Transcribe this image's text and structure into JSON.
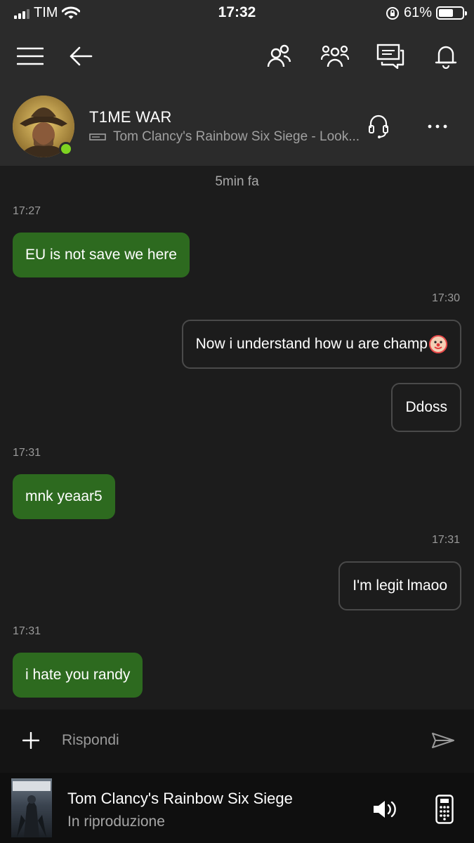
{
  "status_bar": {
    "carrier": "TIM",
    "time": "17:32",
    "battery": "61%",
    "battery_level": 0.61,
    "icons": [
      "signal-icon",
      "wifi-icon",
      "orientation-lock-icon",
      "battery-icon"
    ]
  },
  "nav": {
    "icons": [
      "menu-icon",
      "back-arrow-icon",
      "friends-icon",
      "party-icon",
      "messages-icon",
      "notifications-icon"
    ]
  },
  "contact": {
    "name": "T1ME WAR",
    "status": "Tom Clancy's Rainbow Six Siege - Look...",
    "online": true,
    "icons": [
      "console-icon",
      "headset-icon",
      "more-icon"
    ]
  },
  "messages": {
    "divider": "5min fa",
    "items": [
      {
        "timestamp": "17:27",
        "text": "EU is not save we here",
        "direction": "in"
      },
      {
        "timestamp": "17:30",
        "text": "Now i understand how u are champ",
        "emoji": "clown-face-emoji",
        "direction": "out"
      },
      {
        "timestamp": "",
        "text": "Ddoss",
        "direction": "out"
      },
      {
        "timestamp": "17:31",
        "text": "mnk yeaar5",
        "direction": "in"
      },
      {
        "timestamp": "17:31",
        "text": "I'm legit lmaoo",
        "direction": "out"
      },
      {
        "timestamp": "17:31",
        "text": "i hate you randy",
        "direction": "in"
      }
    ]
  },
  "reply": {
    "placeholder": "Rispondi",
    "value": "",
    "icons": [
      "plus-icon",
      "send-icon"
    ]
  },
  "now_playing": {
    "title": "Tom Clancy's Rainbow Six Siege",
    "subtitle": "In riproduzione",
    "icons": [
      "volume-icon",
      "remote-icon"
    ]
  },
  "colors": {
    "incoming_bubble": "#2d6a1f",
    "online": "#7ed321",
    "background": "#1c1c1c",
    "header": "#2b2b2b"
  }
}
